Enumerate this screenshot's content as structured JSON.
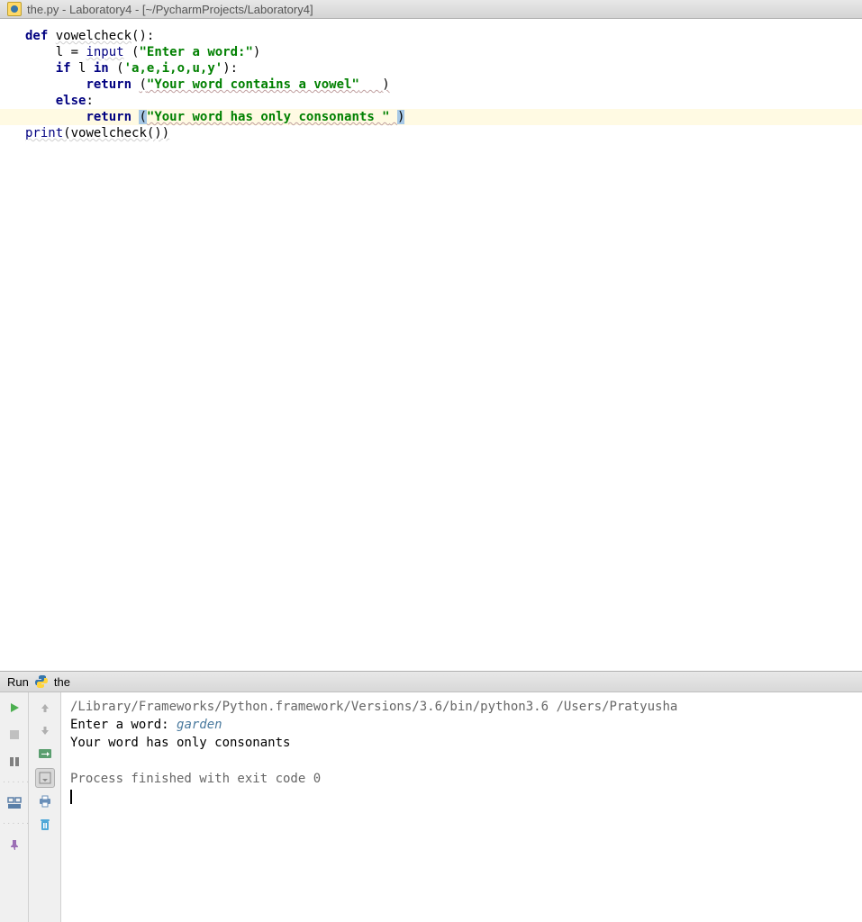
{
  "titleBar": {
    "text": "the.py - Laboratory4 - [~/PycharmProjects/Laboratory4]"
  },
  "code": {
    "line1_def": "def ",
    "line1_fn": "vowelcheck",
    "line1_rest": "():",
    "line2_indent": "    ",
    "line2_var": "l = ",
    "line2_input": "input",
    "line2_space": " ",
    "line2_paren": "(",
    "line2_str": "\"Enter a word:\"",
    "line2_close": ")",
    "line3_indent": "    ",
    "line3_if": "if ",
    "line3_var": "l ",
    "line3_in": "in ",
    "line3_paren": "(",
    "line3_str": "'a,e,i,o,u,y'",
    "line3_close": "):",
    "line4_indent": "        ",
    "line4_return": "return ",
    "line4_paren": "(",
    "line4_str": "\"Your word contains a vowel\"",
    "line4_spaces": "   ",
    "line4_close": ")",
    "line5_indent": "    ",
    "line5_else": "else",
    "line5_colon": ":",
    "line6_indent": "        ",
    "line6_return": "return ",
    "line6_paren": "(",
    "line6_str": "\"Your word has only consonants \"",
    "line6_space": " ",
    "line6_close": ")",
    "line7_print": "print",
    "line7_rest": "(vowelcheck())"
  },
  "runPanel": {
    "label": "Run",
    "configName": "the"
  },
  "console": {
    "path": "/Library/Frameworks/Python.framework/Versions/3.6/bin/python3.6 /Users/Pratyusha",
    "prompt": "Enter a word: ",
    "userInput": "garden",
    "output": "Your word has only consonants ",
    "exitLine": "Process finished with exit code 0"
  }
}
